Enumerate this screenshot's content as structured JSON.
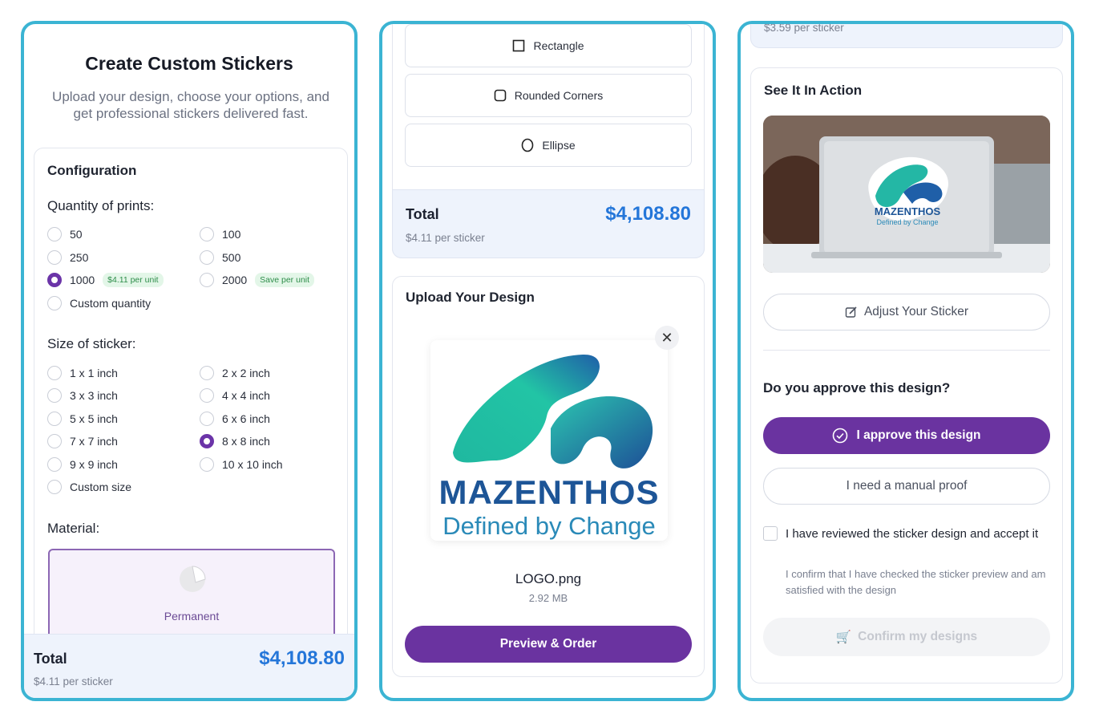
{
  "colors": {
    "accent": "#6a33a0",
    "price": "#2476d9",
    "frame": "#3bb4d3",
    "pill_bg": "#e3f6e8",
    "pill_text": "#2e8d4a"
  },
  "screen1": {
    "title": "Create Custom Stickers",
    "subtitle": "Upload your design, choose your options, and get professional stickers delivered fast.",
    "config_heading": "Configuration",
    "quantity_heading": "Quantity of prints:",
    "quantity_options": [
      {
        "label": "50",
        "selected": false,
        "badge": ""
      },
      {
        "label": "100",
        "selected": false,
        "badge": ""
      },
      {
        "label": "250",
        "selected": false,
        "badge": ""
      },
      {
        "label": "500",
        "selected": false,
        "badge": ""
      },
      {
        "label": "1000",
        "selected": true,
        "badge": "$4.11 per unit"
      },
      {
        "label": "2000",
        "selected": false,
        "badge": "Save per unit"
      },
      {
        "label": "Custom quantity",
        "selected": false,
        "badge": ""
      }
    ],
    "size_heading": "Size of sticker:",
    "size_options": [
      {
        "label": "1 x 1 inch",
        "selected": false
      },
      {
        "label": "2 x 2 inch",
        "selected": false
      },
      {
        "label": "3 x 3 inch",
        "selected": false
      },
      {
        "label": "4 x 4 inch",
        "selected": false
      },
      {
        "label": "5 x 5 inch",
        "selected": false
      },
      {
        "label": "6 x 6 inch",
        "selected": false
      },
      {
        "label": "7 x 7 inch",
        "selected": false
      },
      {
        "label": "8 x 8 inch",
        "selected": true
      },
      {
        "label": "9 x 9 inch",
        "selected": false
      },
      {
        "label": "10 x 10 inch",
        "selected": false
      },
      {
        "label": "Custom size",
        "selected": false
      }
    ],
    "material_heading": "Material:",
    "material_selected": "Permanent",
    "total_label": "Total",
    "total_amount": "$4,108.80",
    "per_sticker": "$4.11 per sticker"
  },
  "screen2": {
    "shapes": [
      {
        "label": "Rectangle",
        "icon": "square-icon"
      },
      {
        "label": "Rounded Corners",
        "icon": "rounded-square-icon"
      },
      {
        "label": "Ellipse",
        "icon": "ellipse-icon"
      }
    ],
    "total_label": "Total",
    "total_amount": "$4,108.80",
    "per_sticker": "$4.11 per sticker",
    "upload_heading": "Upload Your Design",
    "logo_brand": "MAZENTHOS",
    "logo_tagline": "Defined by Change",
    "file_name": "LOGO.png",
    "file_size": "2.92 MB",
    "cta": "Preview & Order"
  },
  "screen3": {
    "top_clipped": "$3.59 per sticker",
    "see_heading": "See It In Action",
    "mockup_brand": "MAZENTHOS",
    "mockup_tagline": "Defined by Change",
    "adjust_label": "Adjust Your Sticker",
    "approve_question": "Do you approve this design?",
    "approve_label": "I approve this design",
    "manual_proof_label": "I need a manual proof",
    "review_label": "I have reviewed the sticker design and accept it",
    "confirm_text": "I confirm that I have checked the sticker preview and am satisfied with the design",
    "confirm_button": "Confirm my designs"
  }
}
